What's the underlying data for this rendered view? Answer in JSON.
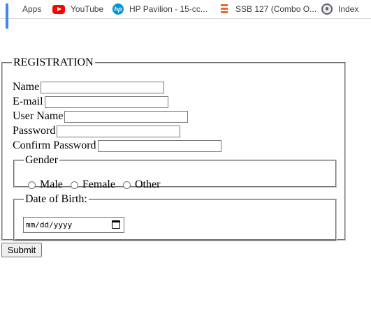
{
  "bookmarks": [
    {
      "label": "Apps",
      "icon": "apps-grid-icon"
    },
    {
      "label": "YouTube",
      "icon": "youtube-icon"
    },
    {
      "label": "HP Pavilion - 15-cc...",
      "icon": "hp-logo-icon"
    },
    {
      "label": "SSB 127 (Combo O...",
      "icon": "stack-icon"
    },
    {
      "label": "Index",
      "icon": "globe-icon"
    }
  ],
  "form": {
    "legend": "REGISTRATION",
    "fields": [
      {
        "label": "Name",
        "value": ""
      },
      {
        "label": "E-mail",
        "value": ""
      },
      {
        "label": "User Name",
        "value": ""
      },
      {
        "label": "Password",
        "value": ""
      },
      {
        "label": "Confirm Password",
        "value": ""
      }
    ],
    "gender": {
      "legend": "Gender",
      "options": [
        "Male",
        "Female",
        "Other"
      ]
    },
    "dob": {
      "legend": "Date of Birth:",
      "placeholder": "mm/dd/yyyy"
    },
    "submit_label": "Submit"
  },
  "colors": {
    "youtube_red": "#ff0000",
    "hp_blue": "#0096d6",
    "ssb_orange": "#e46c2f",
    "apps_blue": "#4285f4"
  }
}
